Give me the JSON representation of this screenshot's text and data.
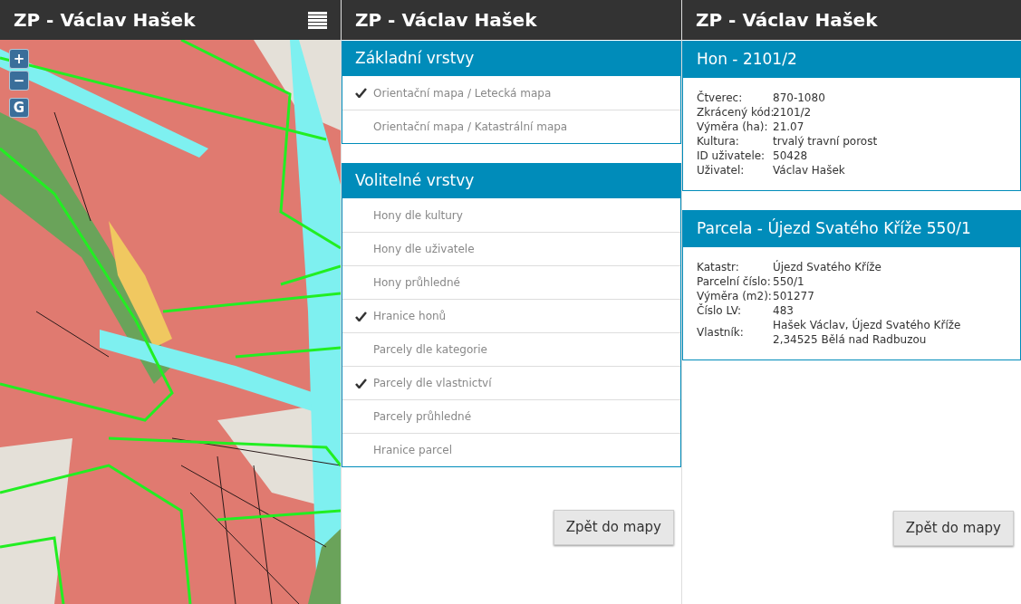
{
  "panels": [
    {
      "title": "ZP - Václav Hašek",
      "map": {
        "controls": [
          {
            "label": "+"
          },
          {
            "label": "−"
          },
          {
            "label": "G"
          }
        ]
      }
    },
    {
      "title": "ZP - Václav Hašek",
      "layer_groups": [
        {
          "title": "Základní vrstvy",
          "items": [
            {
              "label": "Orientační mapa / Letecká mapa",
              "checked": true
            },
            {
              "label": "Orientační mapa / Katastrální mapa",
              "checked": false
            }
          ]
        },
        {
          "title": "Volitelné vrstvy",
          "items": [
            {
              "label": "Hony dle kultury",
              "checked": false
            },
            {
              "label": "Hony dle uživatele",
              "checked": false
            },
            {
              "label": "Hony průhledné",
              "checked": false
            },
            {
              "label": "Hranice honů",
              "checked": true
            },
            {
              "label": "Parcely dle kategorie",
              "checked": false
            },
            {
              "label": "Parcely dle vlastnictví",
              "checked": true
            },
            {
              "label": "Parcely průhledné",
              "checked": false
            },
            {
              "label": "Hranice parcel",
              "checked": false
            }
          ]
        }
      ],
      "button": "Zpět do mapy"
    },
    {
      "title": "ZP - Václav Hašek",
      "info_cards": [
        {
          "title": "Hon - 2101/2",
          "rows": [
            {
              "label": "Čtverec:",
              "value": "870-1080"
            },
            {
              "label": "Zkrácený kód:",
              "value": "2101/2"
            },
            {
              "label": "Výměra (ha):",
              "value": "21.07"
            },
            {
              "label": "Kultura:",
              "value": "trvalý travní porost"
            },
            {
              "label": "ID uživatele:",
              "value": "50428"
            },
            {
              "label": "Uživatel:",
              "value": "Václav Hašek"
            }
          ]
        },
        {
          "title": "Parcela - Újezd Svatého Kříže 550/1",
          "rows": [
            {
              "label": "Katastr:",
              "value": "Újezd Svatého Kříže"
            },
            {
              "label": "Parcelní číslo:",
              "value": "550/1"
            },
            {
              "label": "Výměra (m2):",
              "value": "501277"
            },
            {
              "label": "Číslo LV:",
              "value": "483"
            },
            {
              "label": "Vlastník:",
              "value": "Hašek Václav, Újezd Svatého Kříže 2,34525 Bělá nad Radbuzou"
            }
          ]
        }
      ],
      "button": "Zpět do mapy"
    }
  ]
}
